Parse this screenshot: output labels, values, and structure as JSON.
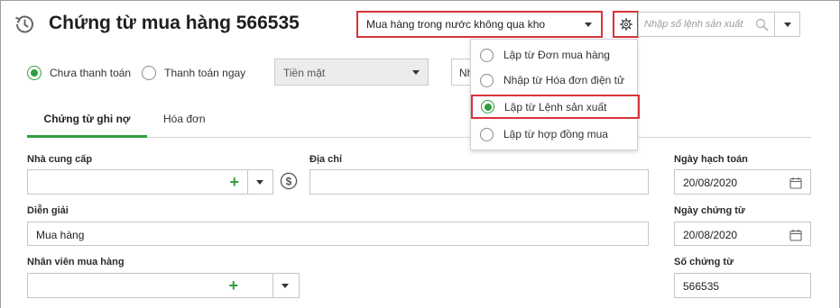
{
  "header": {
    "title": "Chứng từ mua hàng 566535",
    "voucher_type": "Mua hàng trong nước không qua kho",
    "search_placeholder": "Nhập số lệnh sản xuất"
  },
  "payment": {
    "options": [
      {
        "label": "Chưa thanh toán",
        "selected": true
      },
      {
        "label": "Thanh toán ngay",
        "selected": false
      }
    ],
    "method": "Tiền mặt",
    "partial_select_text": "Nh"
  },
  "tabs": [
    {
      "label": "Chứng từ ghi nợ",
      "active": true
    },
    {
      "label": "Hóa đơn",
      "active": false
    }
  ],
  "form": {
    "supplier_label": "Nhà cung cấp",
    "supplier_value": "",
    "address_label": "Địa chỉ",
    "address_value": "",
    "description_label": "Diễn giải",
    "description_value": "Mua hàng",
    "buyer_label": "Nhân viên mua hàng",
    "buyer_value": "",
    "posting_date_label": "Ngày hạch toán",
    "posting_date": "20/08/2020",
    "voucher_date_label": "Ngày chứng từ",
    "voucher_date": "20/08/2020",
    "voucher_no_label": "Số chứng từ",
    "voucher_no": "566535"
  },
  "create_from_menu": {
    "items": [
      {
        "label": "Lập từ Đơn mua hàng",
        "selected": false
      },
      {
        "label": "Nhập từ Hóa đơn điện tử",
        "selected": false
      },
      {
        "label": "Lập từ Lệnh sản xuất",
        "selected": true
      },
      {
        "label": "Lập từ hợp đồng mua",
        "selected": false
      }
    ]
  },
  "colors": {
    "accent_green": "#2f9e3f",
    "highlight_red": "#d9343b"
  },
  "icons": [
    "history-icon",
    "gear-icon",
    "search-icon",
    "dollar-icon",
    "calendar-icon",
    "plus-icon",
    "chevron-down-icon"
  ]
}
